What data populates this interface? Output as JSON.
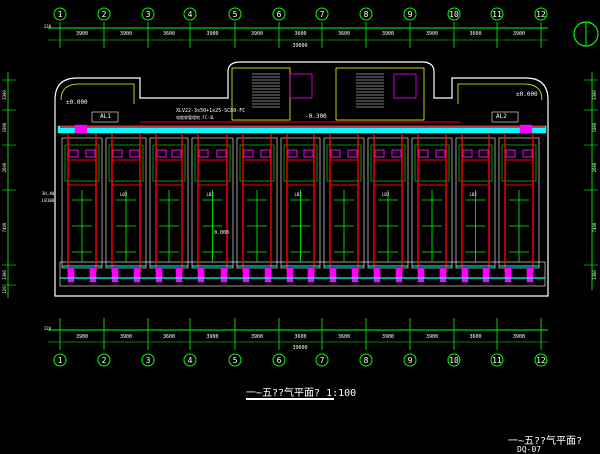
{
  "axis_labels": [
    "1",
    "2",
    "3",
    "4",
    "5",
    "6",
    "7",
    "8",
    "9",
    "10",
    "11",
    "12"
  ],
  "top_dims": [
    "3900",
    "3900",
    "3600",
    "3900",
    "3900",
    "3600",
    "3600",
    "3900",
    "3900",
    "3600",
    "3900"
  ],
  "bottom_dims": [
    "3900",
    "3900",
    "3600",
    "3900",
    "3900",
    "3600",
    "3600",
    "3900",
    "3900",
    "3600",
    "3900"
  ],
  "total_dim_top": "39600",
  "total_dim_bottom": "39600",
  "edge_dim_top": "120",
  "edge_dim_bottom": "120",
  "left_dims": [
    "3300",
    "1800",
    "2600",
    "7400",
    "1300",
    "120"
  ],
  "right_dims": [
    "3300",
    "1800",
    "2600",
    "7400",
    "1300"
  ],
  "panel_left_label": "AL1",
  "panel_right_label": "AL2",
  "level_left": "±0.000",
  "level_right": "±0.000",
  "level_stair": "-0.300",
  "level_center": "0.000",
  "feeder_text": "XLV22-3x50+1x25-SC80-FC",
  "feeder_sub": "电缆穿管埋地 FC-4L",
  "left_side_note": "3H,4W\nLB100",
  "unit_tag": "LB2",
  "plan_title": "一~五??气平面?  1:100",
  "sheet_title": "一~五??气平面?",
  "sheet_no": "DQ-07",
  "colors": {
    "red": "#ff0000",
    "cyan": "#00ffff",
    "magenta": "#ff00ff",
    "green": "#00ff00",
    "yellow": "#ffff00",
    "white": "#ffffff",
    "blue": "#3c6cff"
  }
}
